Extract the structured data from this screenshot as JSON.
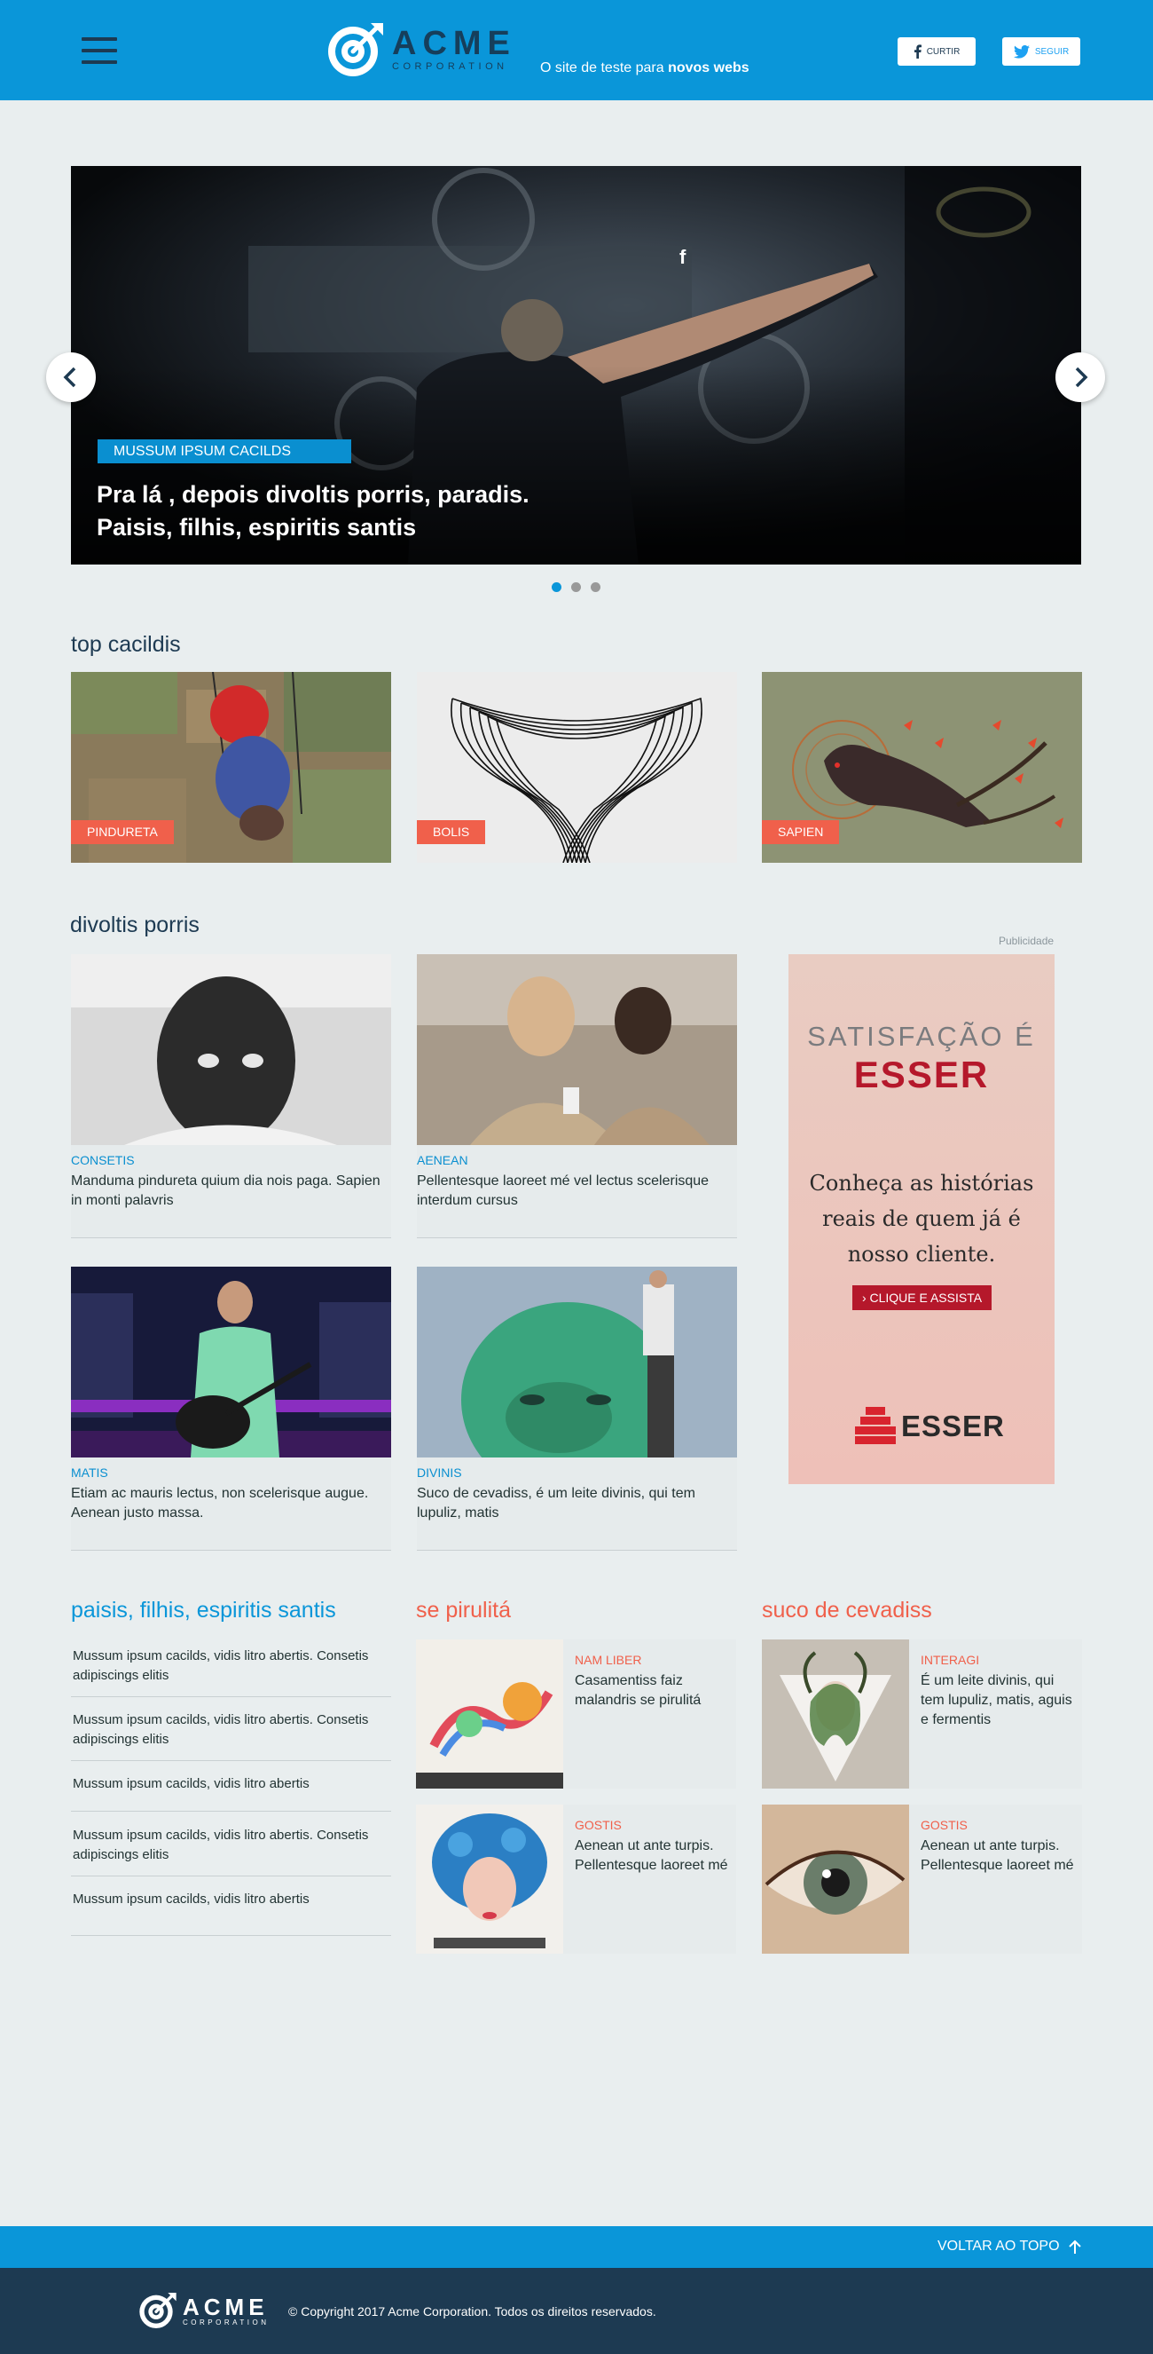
{
  "header": {
    "logo_name": "ACME",
    "logo_sub": "CORPORATION",
    "tagline_prefix": "O site de teste para ",
    "tagline_bold": "novos webs",
    "curtir_label": "CURTIR",
    "seguir_label": "SEGUIR"
  },
  "hero": {
    "tag": "MUSSUM IPSUM CACILDS",
    "title_line1": "Pra lá , depois divoltis porris, paradis.",
    "title_line2": "Paisis, filhis, espiritis santis",
    "share_icon": "f",
    "slides": 3,
    "active_slide": 1
  },
  "top_cacildis": {
    "title": "top cacildis",
    "cards": [
      {
        "label": "PINDURETA"
      },
      {
        "label": "BOLIS"
      },
      {
        "label": "SAPIEN"
      }
    ]
  },
  "divoltis_porris": {
    "title": "divoltis porris",
    "articles": [
      {
        "category": "CONSETIS",
        "text": "Manduma pindureta quium dia nois paga. Sapien in monti palavris"
      },
      {
        "category": "AENEAN",
        "text": "Pellentesque laoreet mé vel lectus scelerisque interdum cursus"
      },
      {
        "category": "MATIS",
        "text": "Etiam ac mauris lectus, non scelerisque augue. Aenean justo massa."
      },
      {
        "category": "DIVINIS",
        "text": "Suco de cevadiss, é um leite divinis, qui tem lupuliz, matis"
      }
    ]
  },
  "ad": {
    "label": "Publicidade",
    "line1": "SATISFAÇÃO É",
    "line2": "ESSER",
    "body1": "Conheça as histórias",
    "body2": "reais de quem já é",
    "body3": "nosso cliente.",
    "cta": "› CLIQUE E ASSISTA",
    "brand": "ESSER"
  },
  "paisis": {
    "title": "paisis, filhis, espiritis santis",
    "items": [
      {
        "text": "Mussum ipsum cacilds, vidis litro abertis. Consetis adipiscings elitis"
      },
      {
        "text": "Mussum ipsum cacilds, vidis litro abertis. Consetis adipiscings elitis"
      },
      {
        "text": "Mussum ipsum cacilds, vidis litro abertis"
      },
      {
        "text": "Mussum ipsum cacilds, vidis litro abertis. Consetis adipiscings elitis"
      },
      {
        "text": "Mussum ipsum cacilds, vidis litro abertis"
      }
    ]
  },
  "pirulita": {
    "title": "se pirulitá",
    "items": [
      {
        "category": "NAM LIBER",
        "text": "Casamentiss faiz malandris se pirulitá"
      },
      {
        "category": "GOSTIS",
        "text": "Aenean ut ante turpis. Pellentesque laoreet mé"
      }
    ]
  },
  "cevadiss": {
    "title": "suco de cevadiss",
    "items": [
      {
        "category": "INTERAGI",
        "text": "É um leite divinis, qui tem lupuliz, matis, aguis e fermentis"
      },
      {
        "category": "GOSTIS",
        "text": "Aenean ut ante turpis. Pellentesque laoreet mé"
      }
    ]
  },
  "footer": {
    "back_to_top": "VOLTAR AO TOPO",
    "logo_name": "ACME",
    "logo_sub": "CORPORATION",
    "copyright": "© Copyright 2017 Acme Corporation. Todos os direitos reservados."
  },
  "colors": {
    "primary_blue": "#0a96d9",
    "dark_navy": "#1d3a52",
    "accent_coral": "#f0604b",
    "background": "#e9eeef"
  }
}
